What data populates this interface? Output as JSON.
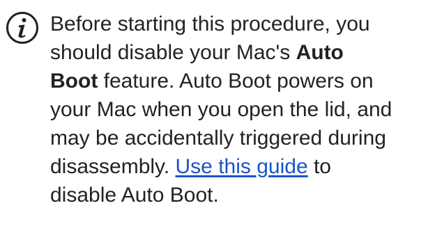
{
  "note": {
    "icon": "info-icon",
    "lines": [
      {
        "segments": [
          {
            "text": "Before starting this procedure, you",
            "style": "normal"
          }
        ]
      },
      {
        "segments": [
          {
            "text": "should disable your Mac's ",
            "style": "normal"
          },
          {
            "text": "Auto",
            "style": "bold"
          }
        ]
      },
      {
        "segments": [
          {
            "text": "Boot",
            "style": "bold"
          },
          {
            "text": " feature. Auto Boot powers on",
            "style": "normal"
          }
        ]
      },
      {
        "segments": [
          {
            "text": "your Mac when you open the lid, and",
            "style": "normal"
          }
        ]
      },
      {
        "segments": [
          {
            "text": "may be accidentally triggered during",
            "style": "normal"
          }
        ]
      },
      {
        "segments": [
          {
            "text": "disassembly. ",
            "style": "normal"
          },
          {
            "text": "Use this guide",
            "style": "link"
          },
          {
            "text": " to",
            "style": "normal"
          }
        ]
      },
      {
        "segments": [
          {
            "text": "disable Auto Boot.",
            "style": "normal"
          }
        ]
      }
    ],
    "link_color": "#1a55c7",
    "text_color": "#222222"
  }
}
